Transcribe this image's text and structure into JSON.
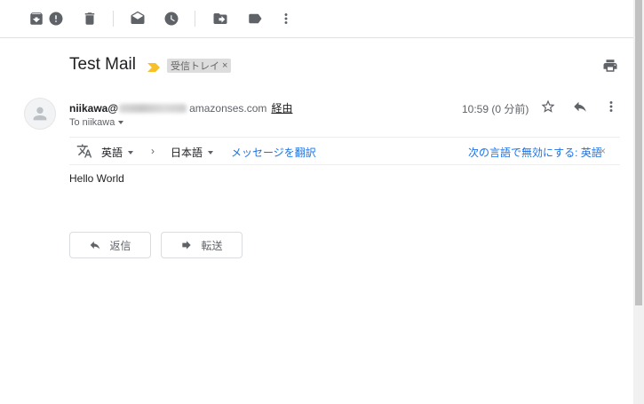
{
  "toolbar": {
    "icons": [
      "archive-icon",
      "report-spam-icon",
      "delete-icon",
      "mark-unread-icon",
      "snooze-icon",
      "move-to-icon",
      "labels-icon",
      "more-vert-icon"
    ]
  },
  "message": {
    "subject": "Test Mail",
    "label_chip": "受信トレイ",
    "label_chip_close": "×",
    "sender_name": "niikawa@",
    "sender_domain": "amazonses.com",
    "via_link": "経由",
    "to_line": "To niikawa",
    "timestamp": "10:59 (0 分前)",
    "body": "Hello World"
  },
  "translate": {
    "source_lang": "英語",
    "arrow": "›",
    "target_lang": "日本語",
    "translate_link": "メッセージを翻訳",
    "disable_link": "次の言語で無効にする: 英語",
    "close": "×"
  },
  "actions": {
    "reply_label": "返信",
    "forward_label": "転送"
  },
  "colors": {
    "link": "#1a73e8",
    "importance_marker": "#f6c026",
    "icon": "#5f6368"
  }
}
